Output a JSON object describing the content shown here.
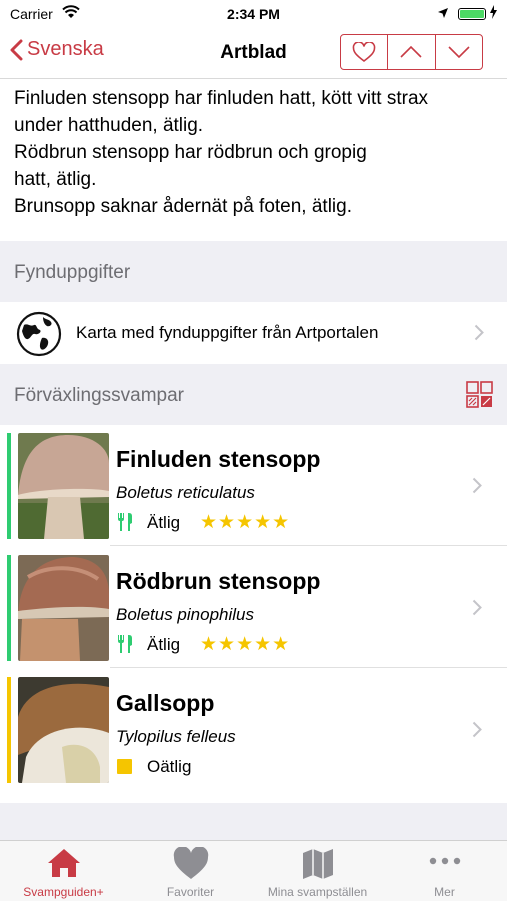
{
  "status_bar": {
    "carrier": "Carrier",
    "time": "2:34 PM"
  },
  "nav": {
    "back_label": "Svenska",
    "title": "Artblad"
  },
  "description": {
    "lines": [
      "Finluden stensopp har finluden hatt, kött vitt strax",
      "under hatthuden, ätlig.",
      "Rödbrun stensopp har rödbrun och gropig",
      "hatt, ätlig.",
      "Brunsopp saknar ådernät på foten, ätlig."
    ]
  },
  "sections": {
    "findings_title": "Fynduppgifter",
    "map_link": "Karta med fynduppgifter från Artportalen",
    "lookalikes_title": "Förväxlingssvampar"
  },
  "lookalikes": [
    {
      "name": "Finluden stensopp",
      "latin": "Boletus reticulatus",
      "edibility": "Ätlig",
      "stars": "★★★★★",
      "color": "#2ecc71",
      "rating": 5
    },
    {
      "name": "Rödbrun stensopp",
      "latin": "Boletus pinophilus",
      "edibility": "Ätlig",
      "stars": "★★★★★",
      "color": "#2ecc71",
      "rating": 5
    },
    {
      "name": "Gallsopp",
      "latin": "Tylopilus felleus",
      "edibility": "Oätlig",
      "stars": "",
      "color": "#f5c500",
      "rating": 0
    }
  ],
  "tabs": [
    {
      "label": "Svampguiden+",
      "icon": "home-icon",
      "active": true
    },
    {
      "label": "Favoriter",
      "icon": "heart-icon",
      "active": false
    },
    {
      "label": "Mina svampställen",
      "icon": "map-icon",
      "active": false
    },
    {
      "label": "Mer",
      "icon": "more-icon",
      "active": false
    }
  ],
  "colors": {
    "accent": "#c83b45",
    "edible": "#2ecc71",
    "inedible": "#f5c500",
    "star": "#f5c500"
  }
}
